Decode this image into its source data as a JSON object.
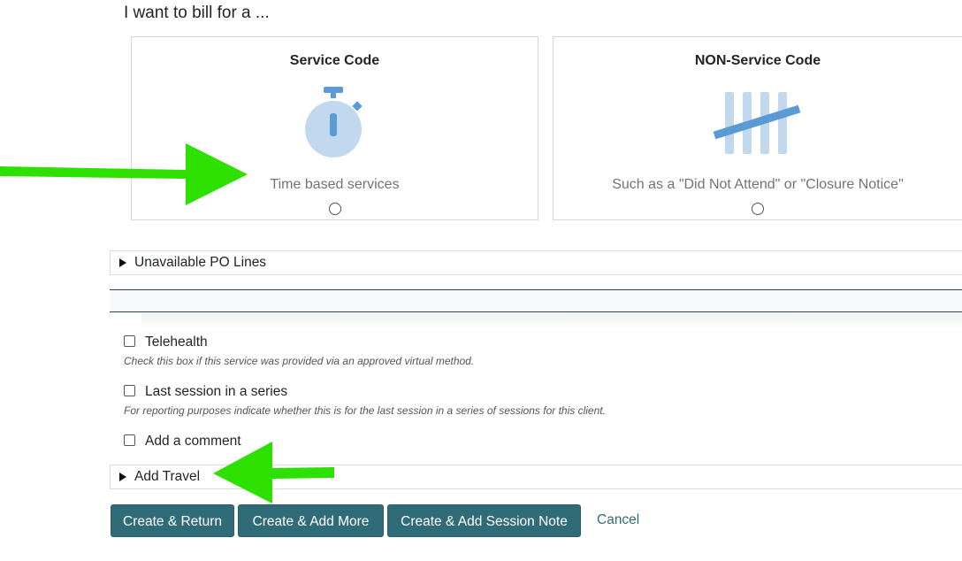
{
  "heading": "I want to bill for a ...",
  "options": {
    "service_code": {
      "title": "Service Code",
      "description": "Time based services",
      "icon": "stopwatch-icon",
      "selected": false
    },
    "non_service_code": {
      "title": "NON-Service Code",
      "description": "Such as a \"Did Not Attend\" or \"Closure Notice\"",
      "icon": "tally-marks-icon",
      "selected": false
    }
  },
  "accordions": {
    "po_lines": "Unavailable PO Lines",
    "travel": "Add Travel"
  },
  "checkboxes": {
    "telehealth": {
      "label": "Telehealth",
      "help": "Check this box if this service was provided via an approved virtual method.",
      "checked": false
    },
    "last_session": {
      "label": "Last session in a series",
      "help": "For reporting purposes indicate whether this is for the last session in a series of sessions for this client.",
      "checked": false
    },
    "comment": {
      "label": "Add a comment",
      "checked": false
    }
  },
  "buttons": {
    "create_return": "Create & Return",
    "create_add_more": "Create & Add More",
    "create_session_note": "Create & Add Session Note",
    "cancel": "Cancel"
  },
  "colors": {
    "primary": "#2f6c78",
    "icon_light": "#c2d8ef",
    "icon_dark": "#5b9bd5",
    "annotation_arrow": "#2de000"
  }
}
